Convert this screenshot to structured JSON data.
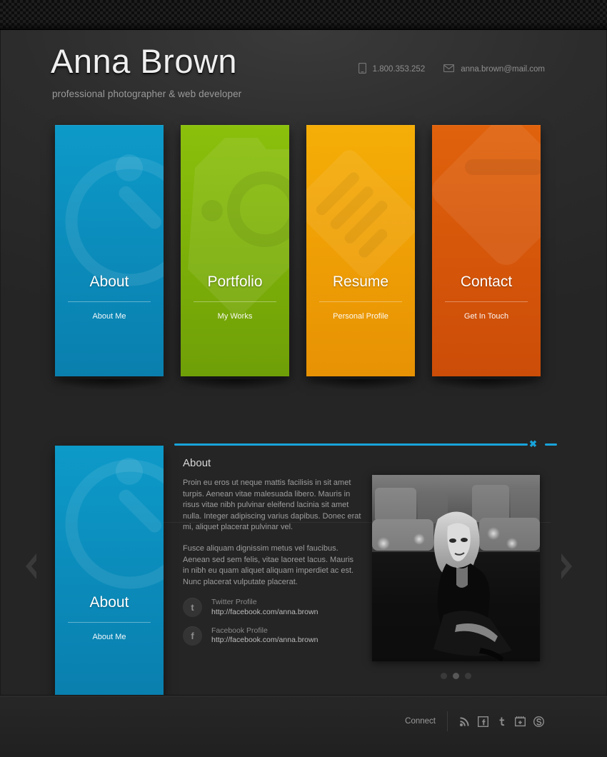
{
  "header": {
    "title": "Anna Brown",
    "tagline": "professional photographer & web developer",
    "phone": "1.800.353.252",
    "email": "anna.brown@mail.com",
    "phone_icon": "phone-icon",
    "email_icon": "envelope-icon"
  },
  "tiles": [
    {
      "label": "About",
      "sub": "About Me",
      "color": "#0b8cbb",
      "icon": "info-bubble-icon"
    },
    {
      "label": "Portfolio",
      "sub": "My Works",
      "color": "#7db009",
      "icon": "camera-icon"
    },
    {
      "label": "Resume",
      "sub": "Personal Profile",
      "color": "#ef9f05",
      "icon": "document-list-icon"
    },
    {
      "label": "Contact",
      "sub": "Get In Touch",
      "color": "#d6560a",
      "icon": "envelope-icon"
    }
  ],
  "panel": {
    "accent_color": "#18a3da",
    "close_label": "✖",
    "preview": {
      "label": "About",
      "sub": "About Me"
    },
    "heading": "About",
    "paragraphs": [
      "Proin eu eros ut neque mattis facilisis in sit amet turpis. Aenean vitae malesuada libero. Mauris in risus vitae nibh pulvinar eleifend lacinia sit amet nulla. Integer adipiscing varius dapibus. Donec erat mi, aliquet placerat pulvinar vel.",
      "Fusce aliquam dignissim metus vel faucibus. Aenean sed sem felis, vitae laoreet lacus. Mauris in nibh eu quam aliquet aliquam imperdiet ac est. Nunc placerat vulputate placerat."
    ],
    "socials": [
      {
        "icon": "twitter-icon",
        "glyph": "t",
        "title": "Twitter Profile",
        "url": "http://facebook.com/anna.brown"
      },
      {
        "icon": "facebook-icon",
        "glyph": "f",
        "title": "Facebook Profile",
        "url": "http://facebook.com/anna.brown"
      }
    ],
    "carousel": {
      "dots": 3,
      "active_index": 1
    },
    "prev_icon": "chevron-left-icon",
    "next_icon": "chevron-right-icon"
  },
  "footer": {
    "connect_label": "Connect",
    "icons": [
      "rss-icon",
      "facebook-icon",
      "twitter-icon",
      "google-plus-icon",
      "skype-icon"
    ]
  }
}
